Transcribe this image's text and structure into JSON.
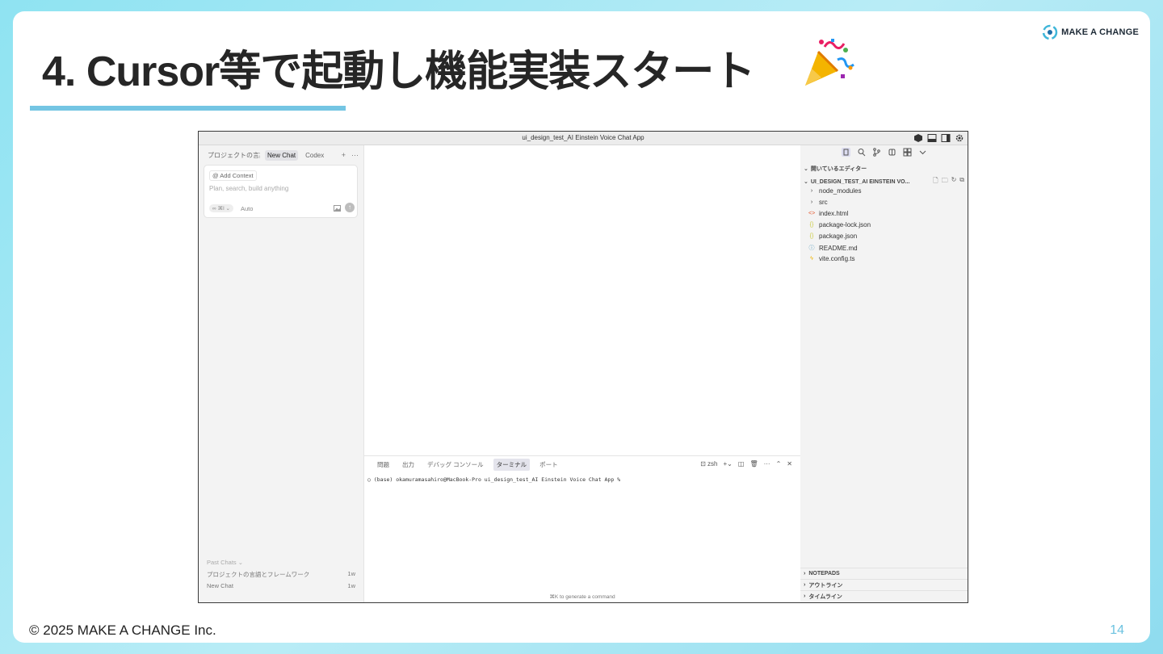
{
  "slide": {
    "title": "4. Cursor等で起動し機能実装スタート",
    "brand": "MAKE A CHANGE",
    "footer": "© 2025 MAKE A CHANGE Inc.",
    "page_number": "14",
    "accent_color": "#74c5e3"
  },
  "app": {
    "window_title": "ui_design_test_AI Einstein Voice Chat App",
    "chat": {
      "tabs": [
        "プロジェクトの言語",
        "New Chat",
        "Codex"
      ],
      "active_tab": "New Chat",
      "add_context": "Add Context",
      "placeholder": "Plan, search, build anything",
      "mode_chip": "∞ ⌘I ⌄",
      "model": "Auto",
      "past_chats_label": "Past Chats ⌄",
      "past_chats": [
        {
          "title": "プロジェクトの言語とフレームワーク",
          "age": "1w"
        },
        {
          "title": "New Chat",
          "age": "1w"
        }
      ]
    },
    "terminal": {
      "tabs": [
        "問題",
        "出力",
        "デバッグ コンソール",
        "ターミナル",
        "ポート"
      ],
      "active_tab": "ターミナル",
      "shell": "zsh",
      "prompt_line": "(base) okamuramasahiro@MacBook-Pro ui_design_test_AI Einstein Voice Chat App %",
      "command_hint": "⌘K to generate a command"
    },
    "explorer": {
      "open_editors": "開いているエディター",
      "project": "UI_DESIGN_TEST_AI EINSTEIN VO...",
      "files": [
        {
          "name": "node_modules",
          "icon": "chevron-right"
        },
        {
          "name": "src",
          "icon": "chevron-right"
        },
        {
          "name": "index.html",
          "icon": "html-icon"
        },
        {
          "name": "package-lock.json",
          "icon": "json-icon"
        },
        {
          "name": "package.json",
          "icon": "json-icon"
        },
        {
          "name": "README.md",
          "icon": "info-icon"
        },
        {
          "name": "vite.config.ts",
          "icon": "vite-icon"
        }
      ],
      "bottom_sections": [
        "NOTEPADS",
        "アウトライン",
        "タイムライン"
      ]
    }
  }
}
